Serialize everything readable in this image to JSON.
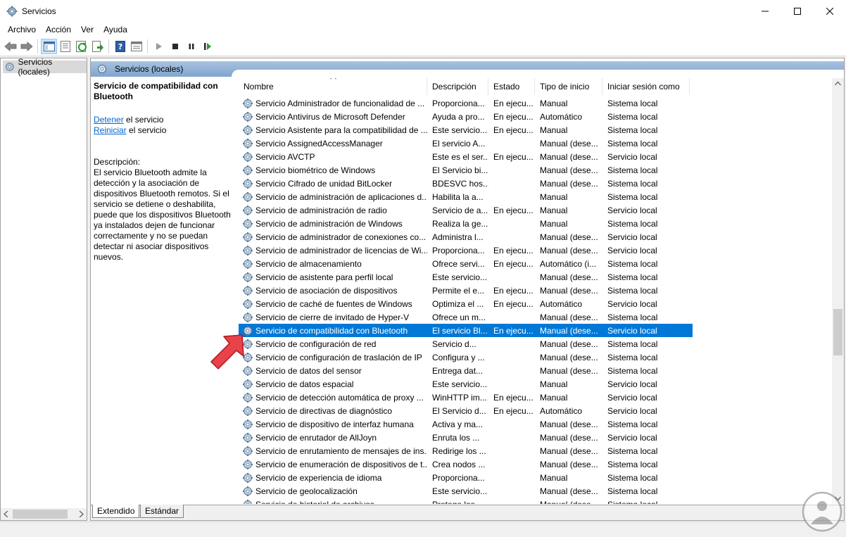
{
  "window": {
    "title": "Servicios",
    "minimize_icon": "minimize-icon",
    "maximize_icon": "maximize-icon",
    "close_icon": "close-icon"
  },
  "menu": [
    "Archivo",
    "Acción",
    "Ver",
    "Ayuda"
  ],
  "toolbar_icons": [
    "back-arrow-icon",
    "forward-arrow-icon",
    "console-tree-icon",
    "properties-sheet-icon",
    "refresh-icon",
    "export-list-icon",
    "help-icon",
    "show-hide-pane-icon",
    "start-service-icon",
    "stop-service-icon",
    "pause-service-icon",
    "restart-service-icon"
  ],
  "tree": {
    "root_label": "Servicios (locales)"
  },
  "pane_header": "Servicios (locales)",
  "details": {
    "service_title": "Servicio de compatibilidad con Bluetooth",
    "stop_link": "Detener",
    "stop_suffix": " el servicio",
    "restart_link": "Reiniciar",
    "restart_suffix": " el servicio",
    "description_label": "Descripción:",
    "description": "El servicio Bluetooth admite la detección y la asociación de dispositivos Bluetooth remotos. Si el servicio se detiene o deshabilita, puede que los dispositivos Bluetooth ya instalados dejen de funcionar correctamente y no se puedan detectar ni asociar dispositivos nuevos."
  },
  "columns": {
    "name": "Nombre",
    "description": "Descripción",
    "status": "Estado",
    "startup": "Tipo de inicio",
    "logon": "Iniciar sesión como"
  },
  "rows": [
    {
      "name": "Servicio Administrador de funcionalidad de ...",
      "desc": "Proporciona...",
      "status": "En ejecu...",
      "startup": "Manual",
      "logon": "Sistema local"
    },
    {
      "name": "Servicio Antivirus de Microsoft Defender",
      "desc": "Ayuda a pro...",
      "status": "En ejecu...",
      "startup": "Automático",
      "logon": "Sistema local"
    },
    {
      "name": "Servicio Asistente para la compatibilidad de ...",
      "desc": "Este servicio...",
      "status": "En ejecu...",
      "startup": "Manual",
      "logon": "Sistema local"
    },
    {
      "name": "Servicio AssignedAccessManager",
      "desc": "El servicio A...",
      "status": "",
      "startup": "Manual (dese...",
      "logon": "Sistema local"
    },
    {
      "name": "Servicio AVCTP",
      "desc": "Este es el ser...",
      "status": "En ejecu...",
      "startup": "Manual (dese...",
      "logon": "Servicio local"
    },
    {
      "name": "Servicio biométrico de Windows",
      "desc": "El Servicio bi...",
      "status": "",
      "startup": "Manual (dese...",
      "logon": "Sistema local"
    },
    {
      "name": "Servicio Cifrado de unidad BitLocker",
      "desc": "BDESVC hos...",
      "status": "",
      "startup": "Manual (dese...",
      "logon": "Sistema local"
    },
    {
      "name": "Servicio de administración de aplicaciones d...",
      "desc": "Habilita la a...",
      "status": "",
      "startup": "Manual",
      "logon": "Sistema local"
    },
    {
      "name": "Servicio de administración de radio",
      "desc": "Servicio de a...",
      "status": "En ejecu...",
      "startup": "Manual",
      "logon": "Servicio local"
    },
    {
      "name": "Servicio de administración de Windows",
      "desc": "Realiza la ge...",
      "status": "",
      "startup": "Manual",
      "logon": "Sistema local"
    },
    {
      "name": "Servicio de administrador de conexiones co...",
      "desc": "Administra l...",
      "status": "",
      "startup": "Manual (dese...",
      "logon": "Servicio local"
    },
    {
      "name": "Servicio de administrador de licencias de Wi...",
      "desc": "Proporciona...",
      "status": "En ejecu...",
      "startup": "Manual (dese...",
      "logon": "Servicio local"
    },
    {
      "name": "Servicio de almacenamiento",
      "desc": "Ofrece servi...",
      "status": "En ejecu...",
      "startup": "Automático (i...",
      "logon": "Sistema local"
    },
    {
      "name": "Servicio de asistente para perfil local",
      "desc": "Este servicio...",
      "status": "",
      "startup": "Manual (dese...",
      "logon": "Sistema local"
    },
    {
      "name": "Servicio de asociación de dispositivos",
      "desc": "Permite el e...",
      "status": "En ejecu...",
      "startup": "Manual (dese...",
      "logon": "Sistema local"
    },
    {
      "name": "Servicio de caché de fuentes de Windows",
      "desc": "Optimiza el ...",
      "status": "En ejecu...",
      "startup": "Automático",
      "logon": "Servicio local"
    },
    {
      "name": "Servicio de cierre de invitado de Hyper-V",
      "desc": "Ofrece un m...",
      "status": "",
      "startup": "Manual (dese...",
      "logon": "Sistema local"
    },
    {
      "name": "Servicio de compatibilidad con Bluetooth",
      "desc": "El servicio Bl...",
      "status": "En ejecu...",
      "startup": "Manual (dese...",
      "logon": "Servicio local",
      "selected": true
    },
    {
      "name": "Servicio de configuración de red",
      "desc": "Servicio d...",
      "status": "",
      "startup": "Manual (dese...",
      "logon": "Sistema local"
    },
    {
      "name": "Servicio de configuración de traslación de IP",
      "desc": "Configura y ...",
      "status": "",
      "startup": "Manual (dese...",
      "logon": "Sistema local"
    },
    {
      "name": "Servicio de datos del sensor",
      "desc": "Entrega dat...",
      "status": "",
      "startup": "Manual (dese...",
      "logon": "Sistema local"
    },
    {
      "name": "Servicio de datos espacial",
      "desc": "Este servicio...",
      "status": "",
      "startup": "Manual",
      "logon": "Servicio local"
    },
    {
      "name": "Servicio de detección automática de proxy ...",
      "desc": "WinHTTP im...",
      "status": "En ejecu...",
      "startup": "Manual",
      "logon": "Servicio local"
    },
    {
      "name": "Servicio de directivas de diagnóstico",
      "desc": "El Servicio d...",
      "status": "En ejecu...",
      "startup": "Automático",
      "logon": "Servicio local"
    },
    {
      "name": "Servicio de dispositivo de interfaz humana",
      "desc": "Activa y ma...",
      "status": "",
      "startup": "Manual (dese...",
      "logon": "Sistema local"
    },
    {
      "name": "Servicio de enrutador de AllJoyn",
      "desc": "Enruta los ...",
      "status": "",
      "startup": "Manual (dese...",
      "logon": "Servicio local"
    },
    {
      "name": "Servicio de enrutamiento de mensajes de ins...",
      "desc": "Redirige los ...",
      "status": "",
      "startup": "Manual (dese...",
      "logon": "Sistema local"
    },
    {
      "name": "Servicio de enumeración de dispositivos de t...",
      "desc": "Crea nodos ...",
      "status": "",
      "startup": "Manual (dese...",
      "logon": "Sistema local"
    },
    {
      "name": "Servicio de experiencia de idioma",
      "desc": "Proporciona...",
      "status": "",
      "startup": "Manual",
      "logon": "Sistema local"
    },
    {
      "name": "Servicio de geolocalización",
      "desc": "Este servicio...",
      "status": "",
      "startup": "Manual (dese...",
      "logon": "Sistema local"
    },
    {
      "name": "Servicio de historial de archivos",
      "desc": "Protege los ...",
      "status": "",
      "startup": "Manual (dese...",
      "logon": "Sistema local"
    }
  ],
  "tabs": {
    "extended": "Extendido",
    "standard": "Estándar"
  },
  "annotation_icon": "pointer-arrow-icon",
  "watermark_icon": "watermark-logo-icon"
}
